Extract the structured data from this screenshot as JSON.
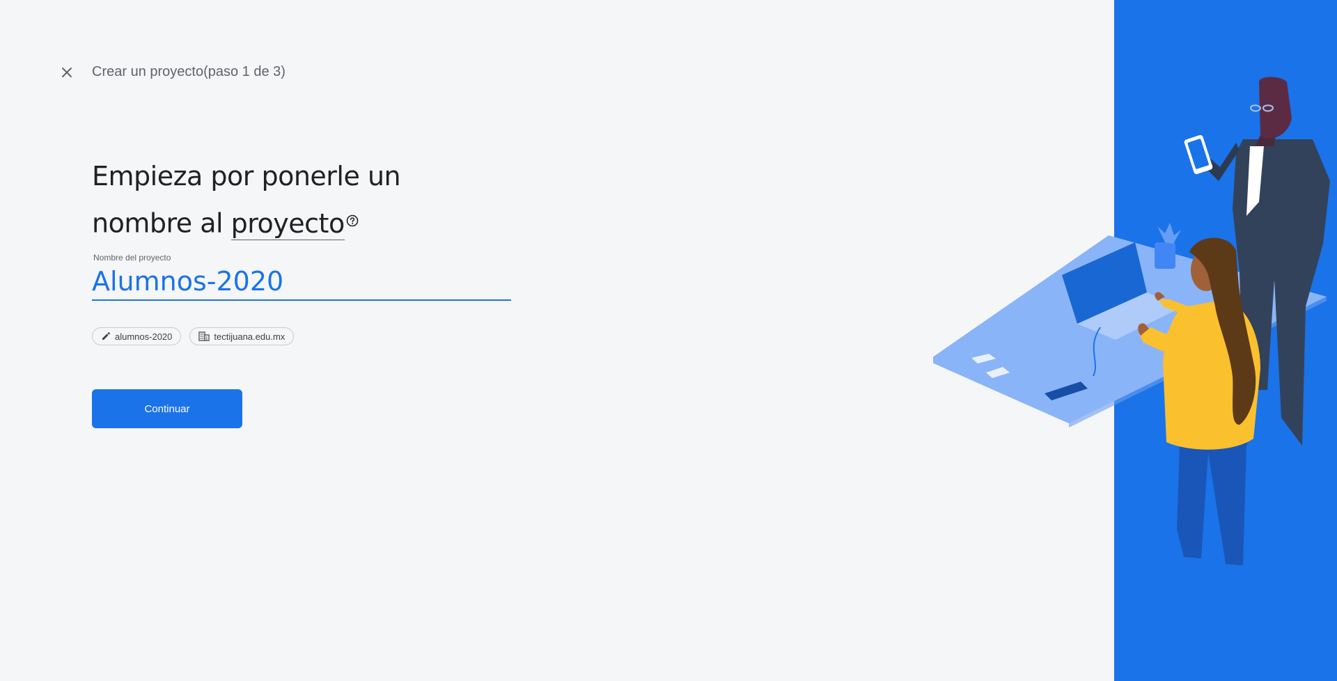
{
  "header": {
    "close_icon": "close-icon",
    "title": "Crear un proyecto(paso 1 de 3)"
  },
  "main": {
    "heading_part1": "Empieza por ponerle un",
    "heading_part2": "nombre al ",
    "heading_term": "proyecto",
    "help_icon": "help-circle-icon",
    "field": {
      "label": "Nombre del proyecto",
      "value": "Alumnos-2020"
    },
    "chips": [
      {
        "icon": "pencil-icon",
        "label": "alumnos-2020"
      },
      {
        "icon": "building-icon",
        "label": "tectijuana.edu.mx"
      }
    ],
    "continue_label": "Continuar"
  },
  "colors": {
    "accent": "#1a73e8",
    "background": "#f5f6f8",
    "illustration_panel": "#1a73e8"
  }
}
